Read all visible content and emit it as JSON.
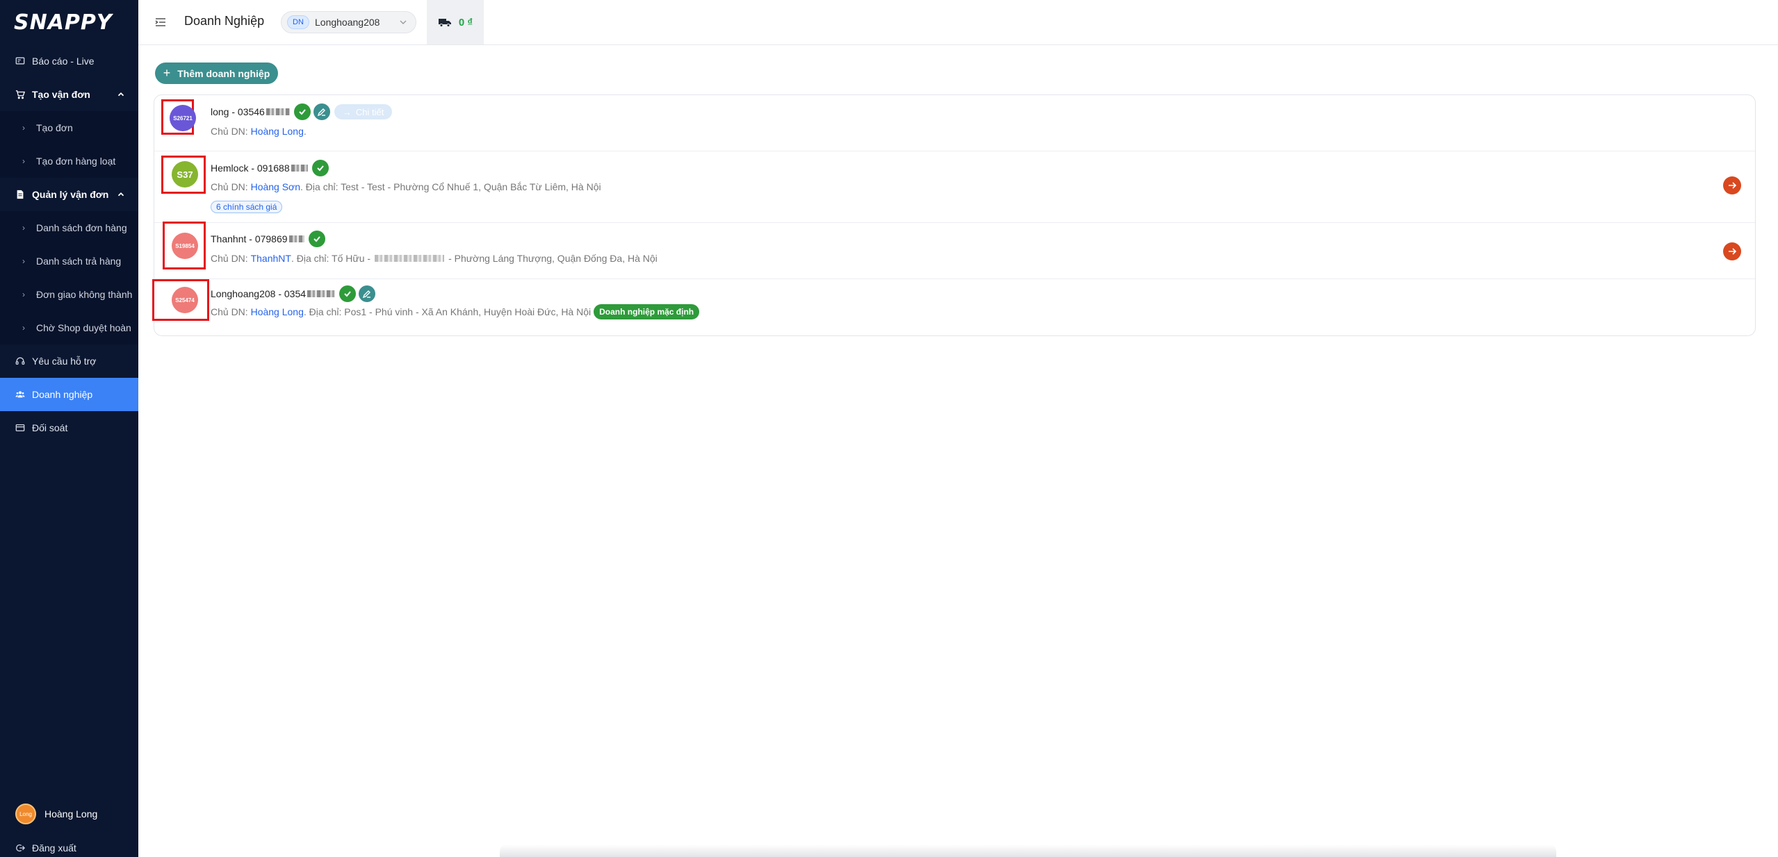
{
  "sidebar": {
    "logo": "SNAPPY",
    "items": [
      {
        "label": "Báo cáo - Live"
      },
      {
        "label": "Tạo vận đơn"
      },
      {
        "label": "Tạo đơn"
      },
      {
        "label": "Tạo đơn hàng loạt"
      },
      {
        "label": "Quản lý vận đơn"
      },
      {
        "label": "Danh sách đơn hàng"
      },
      {
        "label": "Danh sách trả hàng"
      },
      {
        "label": "Đơn giao không thành"
      },
      {
        "label": "Chờ Shop duyệt hoàn"
      },
      {
        "label": "Yêu cầu hỗ trợ"
      },
      {
        "label": "Doanh nghiệp"
      },
      {
        "label": "Đối soát"
      }
    ],
    "user": {
      "name": "Hoàng Long",
      "avatar_text": "Long"
    },
    "logout_label": "Đăng xuất"
  },
  "header": {
    "title": "Doanh Nghiệp",
    "business_badge": "DN",
    "business_name": "Longhoang208",
    "wallet_balance": "0 ₫"
  },
  "main": {
    "add_button_label": "Thêm doanh nghiệp",
    "businesses": [
      {
        "avatar_text": "S26721",
        "avatar_color": "#6a57d8",
        "title": "long - 03546",
        "detail_label": "Chi tiết",
        "owner_prefix": "Chủ DN: ",
        "owner": "Hoàng Long",
        "address_text": "."
      },
      {
        "avatar_text": "S37",
        "avatar_color": "#86b52f",
        "title": "Hemlock - 091688",
        "owner_prefix": "Chủ DN: ",
        "owner": "Hoàng Sơn",
        "address_text": ". Địa chỉ: Test - Test - Phường Cổ Nhuế 1, Quận Bắc Từ Liêm, Hà Nội",
        "price_policies": "6 chính sách giá"
      },
      {
        "avatar_text": "S19854",
        "avatar_color": "#ee7b78",
        "title": "Thanhnt - 079869",
        "owner_prefix": "Chủ DN: ",
        "owner": "ThanhNT",
        "address_pre": ". Địa chỉ: Tố Hữu -",
        "address_post": "- Phường Láng Thượng, Quận Đống Đa, Hà Nội"
      },
      {
        "avatar_text": "S25474",
        "avatar_color": "#ee7b78",
        "title": "Longhoang208 - 0354",
        "owner_prefix": "Chủ DN: ",
        "owner": "Hoàng Long",
        "address_text": ". Địa chỉ: Pos1 - Phú vinh - Xã An Khánh, Huyện Hoài Đức, Hà Nội",
        "default_badge": "Doanh nghiệp mặc định"
      }
    ]
  },
  "colors": {
    "sidebar_bg": "#0b1730",
    "active_item": "#3b82f6",
    "primary_teal": "#3b8f8f",
    "verified_green": "#2e9b3a",
    "arrow_orange": "#d9481f",
    "highlight_box": "#e5141b"
  },
  "icons": [
    "report-icon",
    "cart-icon",
    "document-icon",
    "headset-icon",
    "users-icon",
    "card-icon",
    "logout-icon",
    "menu-icon",
    "truck-icon",
    "check-icon",
    "edit-icon",
    "arrow-right-icon",
    "chevron-up-icon",
    "chevron-down-icon"
  ]
}
